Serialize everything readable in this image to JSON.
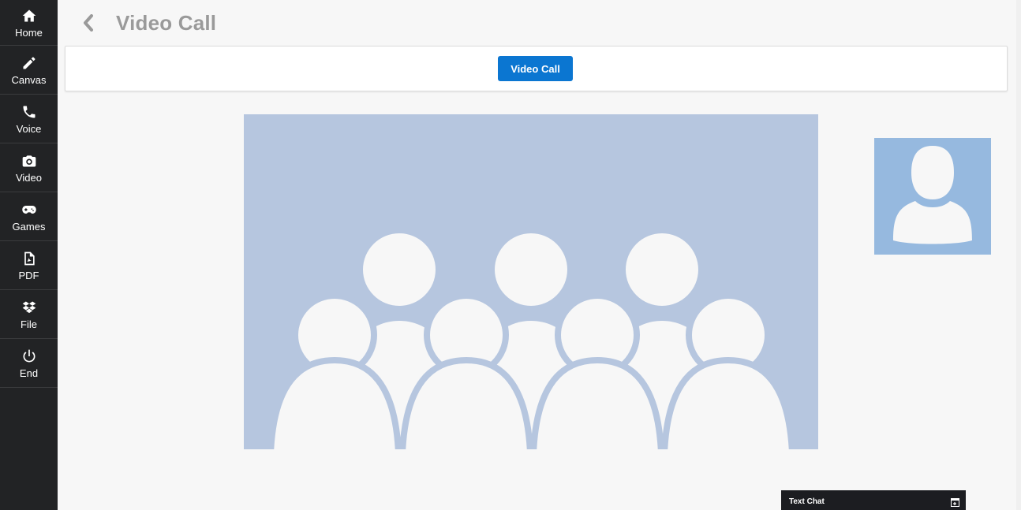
{
  "sidebar": {
    "items": [
      {
        "label": "Home",
        "icon": "home-icon"
      },
      {
        "label": "Canvas",
        "icon": "pencil-icon"
      },
      {
        "label": "Voice",
        "icon": "phone-icon"
      },
      {
        "label": "Video",
        "icon": "camera-icon"
      },
      {
        "label": "Games",
        "icon": "gamepad-icon"
      },
      {
        "label": "PDF",
        "icon": "pdf-file-icon"
      },
      {
        "label": "File",
        "icon": "dropbox-icon"
      },
      {
        "label": "End",
        "icon": "power-icon"
      }
    ]
  },
  "header": {
    "title": "Video Call",
    "back_icon": "chevron-left-icon"
  },
  "toolbar": {
    "video_call_label": "Video Call"
  },
  "remote_video": {
    "placeholder_icon": "group-avatar-icon"
  },
  "local_video": {
    "placeholder_icon": "user-avatar-icon"
  },
  "text_chat": {
    "label": "Text Chat",
    "icon": "expand-window-icon"
  },
  "colors": {
    "sidebar_bg": "#222325",
    "accent": "#0b76d1",
    "remote_placeholder_bg": "#b6c6df",
    "local_placeholder_bg": "#96b9df",
    "title_color": "#9a9a9a",
    "chat_bar_bg": "#1c1d21"
  }
}
